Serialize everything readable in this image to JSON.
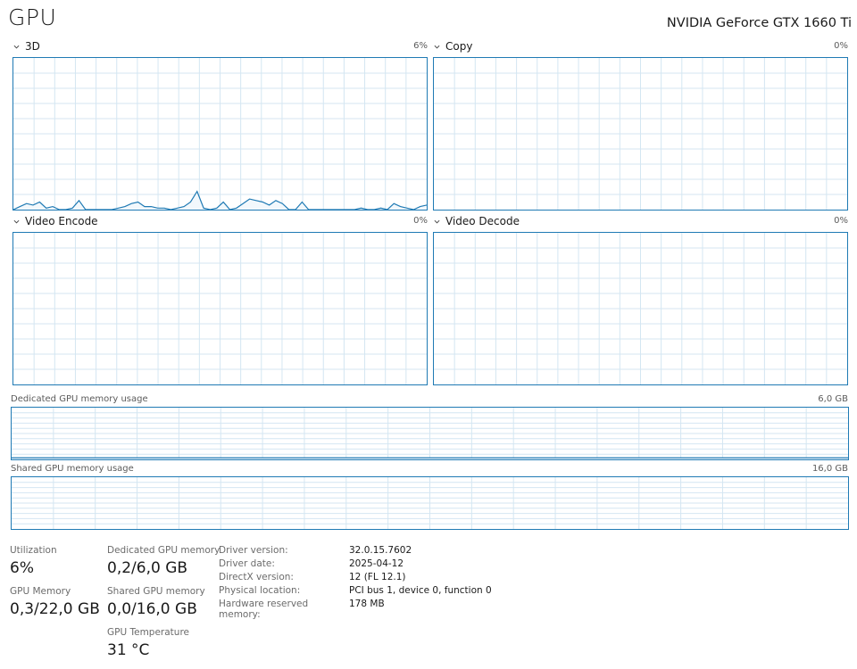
{
  "header": {
    "title": "GPU",
    "device": "NVIDIA GeForce GTX 1660 Ti"
  },
  "engines": [
    {
      "label": "3D",
      "pct": "6%",
      "series": [
        0,
        2,
        4,
        3,
        5,
        1,
        2,
        0,
        0,
        1,
        6,
        0,
        0,
        0,
        0,
        0,
        1,
        2,
        4,
        5,
        2,
        2,
        1,
        1,
        0,
        1,
        2,
        5,
        12,
        1,
        0,
        1,
        5,
        0,
        1,
        4,
        7,
        6,
        5,
        3,
        6,
        4,
        0,
        0,
        5,
        0,
        0,
        0,
        0,
        0,
        0,
        0,
        0,
        1,
        0,
        0,
        1,
        0,
        4,
        2,
        1,
        0,
        2,
        3
      ]
    },
    {
      "label": "Copy",
      "pct": "0%",
      "series": []
    },
    {
      "label": "Video Encode",
      "pct": "0%",
      "series": []
    },
    {
      "label": "Video Decode",
      "pct": "0%",
      "series": []
    }
  ],
  "memory_graphs": [
    {
      "label": "Dedicated GPU memory usage",
      "max": "6,0 GB",
      "usage": 0.03
    },
    {
      "label": "Shared GPU memory usage",
      "max": "16,0 GB",
      "usage": 0.0
    }
  ],
  "stats": {
    "utilization": {
      "label": "Utilization",
      "value": "6%"
    },
    "gpu_memory": {
      "label": "GPU Memory",
      "value": "0,3/22,0 GB"
    },
    "dedicated_memory": {
      "label": "Dedicated GPU memory",
      "value": "0,2/6,0 GB"
    },
    "shared_memory": {
      "label": "Shared GPU memory",
      "value": "0,0/16,0 GB"
    },
    "temperature": {
      "label": "GPU Temperature",
      "value": "31 °C"
    }
  },
  "details": [
    {
      "key": "Driver version:",
      "value": "32.0.15.7602"
    },
    {
      "key": "Driver date:",
      "value": "2025-04-12"
    },
    {
      "key": "DirectX version:",
      "value": "12 (FL 12.1)"
    },
    {
      "key": "Physical location:",
      "value": "PCI bus 1, device 0, function 0"
    },
    {
      "key": "Hardware reserved memory:",
      "value": "178 MB"
    }
  ],
  "colors": {
    "line": "#1f7ab4",
    "grid": "#d4e6f2",
    "fill": "#f2f8fc"
  }
}
